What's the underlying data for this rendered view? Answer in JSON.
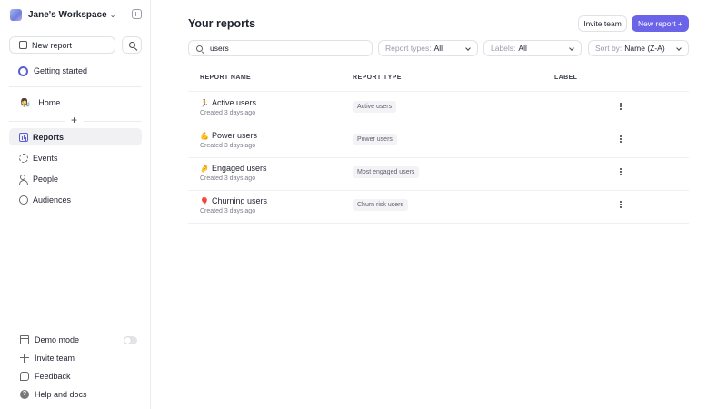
{
  "sidebar": {
    "workspace_name": "Jane's Workspace",
    "new_report_label": "New report",
    "getting_started_label": "Getting started",
    "home_label": "Home",
    "home_emoji": "👩‍🔬",
    "nav": [
      {
        "label": "Reports",
        "icon": "reports-icon",
        "active": true
      },
      {
        "label": "Events",
        "icon": "events-icon",
        "active": false
      },
      {
        "label": "People",
        "icon": "people-icon",
        "active": false
      },
      {
        "label": "Audiences",
        "icon": "audiences-icon",
        "active": false
      }
    ],
    "bottom": [
      {
        "label": "Demo mode",
        "icon": "demo-mode-icon"
      },
      {
        "label": "Invite team",
        "icon": "plus-icon"
      },
      {
        "label": "Feedback",
        "icon": "feedback-icon"
      },
      {
        "label": "Help and docs",
        "icon": "help-icon"
      }
    ],
    "help_glyph": "?"
  },
  "main": {
    "title": "Your reports",
    "invite_label": "Invite team",
    "new_report_label": "New report +",
    "search": {
      "value": "users"
    },
    "filters": [
      {
        "key": "Report types:",
        "value": "All"
      },
      {
        "key": "Labels:",
        "value": "All"
      },
      {
        "key": "Sort by:",
        "value": "Name (Z-A)"
      }
    ],
    "columns": [
      "REPORT NAME",
      "REPORT TYPE",
      "LABEL"
    ],
    "rows": [
      {
        "emoji": "🏃",
        "name": "Active users",
        "created": "Created 3 days ago",
        "type": "Active users"
      },
      {
        "emoji": "💪",
        "name": "Power users",
        "created": "Created 3 days ago",
        "type": "Power users"
      },
      {
        "emoji": "🤌",
        "name": "Engaged users",
        "created": "Created 3 days ago",
        "type": "Most engaged users"
      },
      {
        "emoji": "🎈",
        "name": "Churning users",
        "created": "Created 3 days ago",
        "type": "Churn risk users"
      }
    ]
  },
  "colors": {
    "accent": "#6b63e8",
    "active_nav_bg": "#f1f1f4"
  }
}
